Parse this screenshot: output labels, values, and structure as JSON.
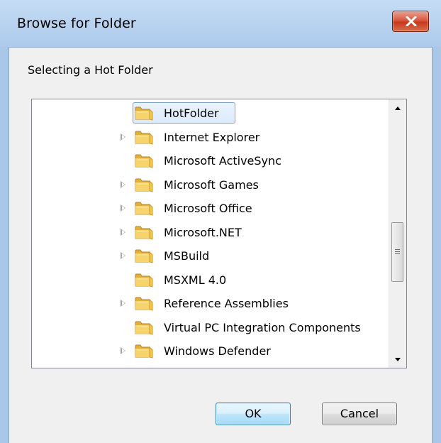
{
  "window": {
    "title": "Browse for Folder",
    "close_icon": "close-x-icon"
  },
  "dialog": {
    "description": "Selecting a Hot Folder"
  },
  "tree": {
    "selected_index": 0,
    "items": [
      {
        "label": "HotFolder",
        "expandable": false,
        "selected": true
      },
      {
        "label": "Internet Explorer",
        "expandable": true,
        "selected": false
      },
      {
        "label": "Microsoft ActiveSync",
        "expandable": false,
        "selected": false
      },
      {
        "label": "Microsoft Games",
        "expandable": true,
        "selected": false
      },
      {
        "label": "Microsoft Office",
        "expandable": true,
        "selected": false
      },
      {
        "label": "Microsoft.NET",
        "expandable": true,
        "selected": false
      },
      {
        "label": "MSBuild",
        "expandable": true,
        "selected": false
      },
      {
        "label": "MSXML 4.0",
        "expandable": false,
        "selected": false
      },
      {
        "label": "Reference Assemblies",
        "expandable": true,
        "selected": false
      },
      {
        "label": "Virtual PC Integration Components",
        "expandable": false,
        "selected": false
      },
      {
        "label": "Windows Defender",
        "expandable": true,
        "selected": false
      }
    ]
  },
  "buttons": {
    "ok_label": "OK",
    "cancel_label": "Cancel"
  },
  "colors": {
    "title_bar": "#b9d3ee",
    "close_button": "#c7391d",
    "selection": "#dcebfc",
    "folder": "#f2c94c"
  }
}
